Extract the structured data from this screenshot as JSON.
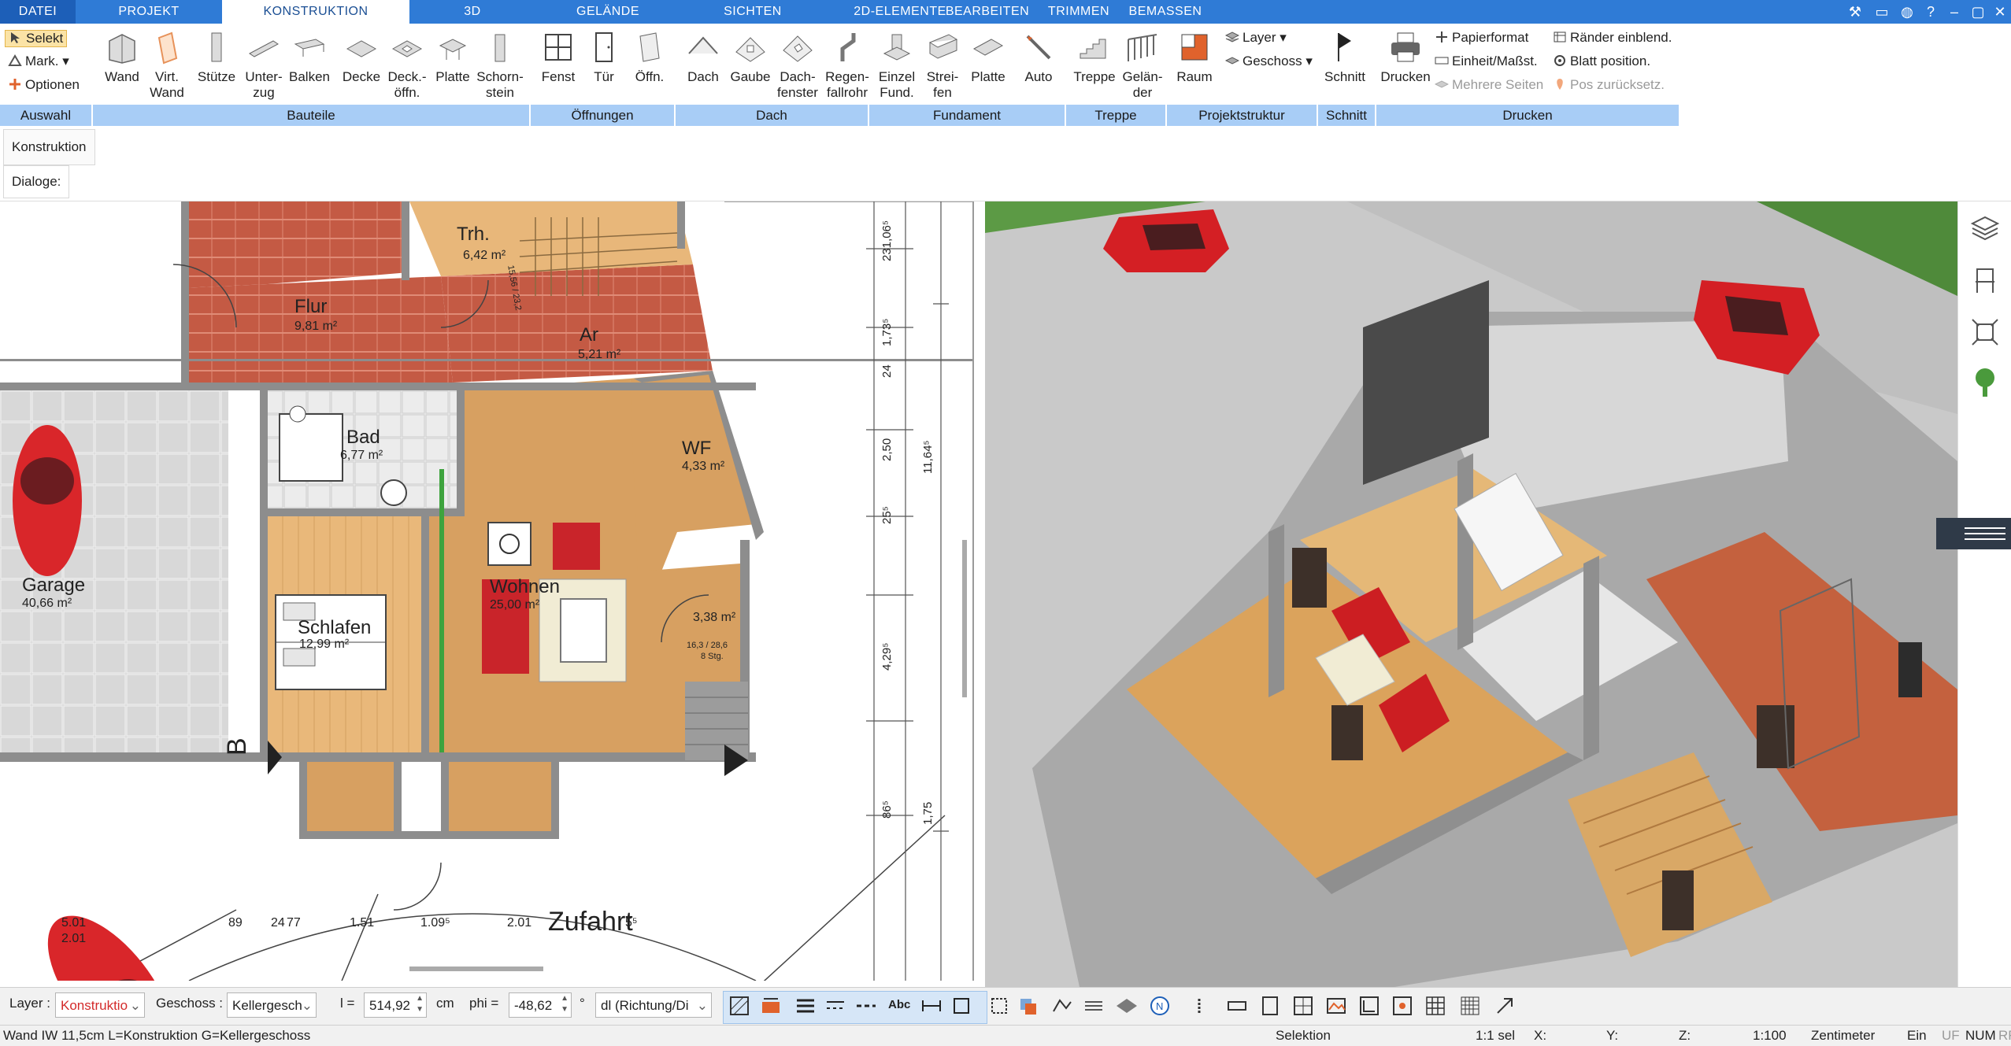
{
  "menu": {
    "tabs": [
      "DATEI",
      "PROJEKT",
      "KONSTRUKTION",
      "3D",
      "GELÄNDE",
      "SICHTEN",
      "2D-ELEMENTE",
      "BEARBEITEN",
      "TRIMMEN",
      "BEMASSEN"
    ],
    "active": "KONSTRUKTION"
  },
  "ribbon": {
    "auswahl": {
      "select_label": "Selekt",
      "mark_label": "Mark.",
      "options_label": "Optionen"
    },
    "bauteile": [
      "Wand",
      "Virt. Wand",
      "Stütze",
      "Unter- zug",
      "Balken",
      "Decke",
      "Deck.- öffn.",
      "Platte",
      "Schorn- stein"
    ],
    "oeffnungen": [
      "Fenst",
      "Tür",
      "Öffn."
    ],
    "dach": [
      "Dach",
      "Gaube",
      "Dach- fenster",
      "Regen- fallrohr"
    ],
    "fundament": [
      "Einzel Fund.",
      "Strei- fen",
      "Platte"
    ],
    "auto": "Auto",
    "treppe": [
      "Treppe",
      "Gelän- der"
    ],
    "projektstruktur": {
      "raum": "Raum",
      "layer": "Layer",
      "geschoss": "Geschoss"
    },
    "schnitt": "Schnitt",
    "drucken": {
      "drucken": "Drucken",
      "papierformat": "Papierformat",
      "einheit": "Einheit/Maßst.",
      "mehrere": "Mehrere Seiten",
      "raender": "Ränder einblend.",
      "blatt": "Blatt position.",
      "pos": "Pos zurücksetz."
    },
    "groups": [
      "Auswahl",
      "Bauteile",
      "Öffnungen",
      "Dach",
      "Fundament",
      "Treppe",
      "Projektstruktur",
      "Schnitt",
      "Drucken"
    ]
  },
  "dialog": {
    "tab": "Konstruktion",
    "label": "Dialoge:"
  },
  "plan": {
    "rooms": [
      {
        "name": "Trh.",
        "area": "6,42 m²"
      },
      {
        "name": "Flur",
        "area": "9,81 m²"
      },
      {
        "name": "Ar",
        "area": "5,21 m²"
      },
      {
        "name": "Bad",
        "area": "6,77 m²"
      },
      {
        "name": "WF",
        "area": "4,33 m²"
      },
      {
        "name": "Wohnen",
        "area": "25,00 m²"
      },
      {
        "name": "Schlafen",
        "area": "12,99 m²"
      },
      {
        "name": "Garage",
        "area": "40,66 m²"
      },
      {
        "name": "",
        "area": "3,38 m²"
      }
    ],
    "stair_note": "15,56 / 23,2",
    "stair_note2": "16,3 / 28,6",
    "stair_steps": "8 Stg.",
    "section_mark": "B",
    "zufahrt": "Zufahrt",
    "dims_vertical": [
      "231,06⁵",
      "1,73⁵",
      "24",
      "2,50",
      "11,64⁵",
      "25⁵",
      "4,29⁵",
      "86⁵",
      "1,75"
    ],
    "dims_bottom": [
      "5.01",
      "2.01",
      "89",
      "24",
      "77",
      "1.51",
      "1.09⁵",
      "2.01",
      "5⁵"
    ]
  },
  "toolbar": {
    "layer_label": "Layer :",
    "layer_value": "Konstruktio",
    "geschoss_label": "Geschoss :",
    "geschoss_value": "Kellergesch",
    "l_label": "l =",
    "l_value": "514,92",
    "l_unit": "cm",
    "phi_label": "phi =",
    "phi_value": "-48,62",
    "phi_unit": "°",
    "dl_value": "dl (Richtung/Di"
  },
  "status": {
    "left": "Wand IW 11,5cm L=Konstruktion G=Kellergeschoss",
    "mode": "Selektion",
    "sel": "1:1 sel",
    "x": "X:",
    "y": "Y:",
    "z": "Z:",
    "scale": "1:100",
    "unit": "Zentimeter",
    "ein": "Ein",
    "uf": "UF",
    "num": "NUM",
    "rf": "RF"
  }
}
